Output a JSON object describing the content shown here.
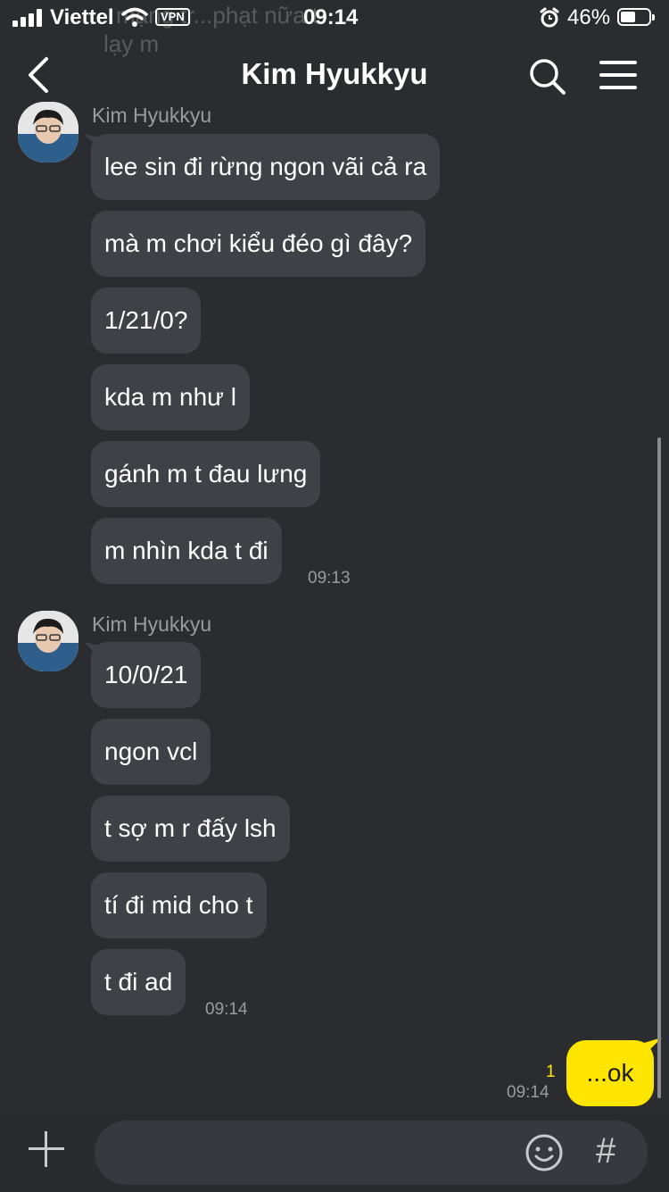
{
  "status_bar": {
    "carrier": "Viettel",
    "vpn": "VPN",
    "time": "09:14",
    "battery": "46%"
  },
  "ghost_preview": [
    "mạng tr...phạt nữa t",
    "lạy m"
  ],
  "header": {
    "title": "Kim Hyukkyu",
    "icons": [
      "back-icon",
      "search-icon",
      "menu-icon"
    ]
  },
  "messages": {
    "group1": {
      "sender": "Kim Hyukkyu",
      "lines": [
        "lee sin đi rừng ngon vãi cả ra",
        "mà m chơi kiểu đéo gì đây?",
        "1/21/0?",
        "kda m như l",
        "gánh m t đau lưng",
        "m nhìn kda t đi"
      ],
      "time": "09:13"
    },
    "group2": {
      "sender": "Kim Hyukkyu",
      "lines": [
        "10/0/21",
        "ngon vcl",
        "t sợ m r đấy lsh",
        "tí đi mid cho t",
        "t đi ad"
      ],
      "time": "09:14"
    },
    "mine": {
      "text": "...ok",
      "unread": "1",
      "time": "09:14"
    }
  },
  "input": {
    "placeholder": "",
    "icons": [
      "plus-icon",
      "emoji-icon",
      "hashtag-icon"
    ],
    "hash_symbol": "#"
  },
  "colors": {
    "background": "#2b2c30",
    "bubble_other": "#404146",
    "bubble_mine": "#fde500",
    "unread": "#fde500"
  }
}
